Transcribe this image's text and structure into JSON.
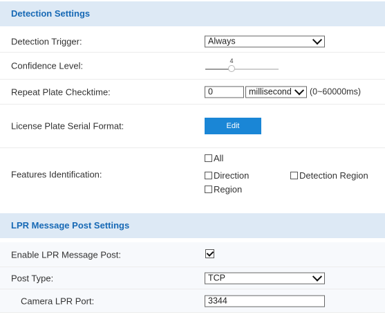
{
  "detection": {
    "header": "Detection Settings",
    "trigger": {
      "label": "Detection Trigger:",
      "value": "Always"
    },
    "confidence": {
      "label": "Confidence Level:",
      "value": "4",
      "level": 0.36
    },
    "repeat": {
      "label": "Repeat Plate Checktime:",
      "value": "0",
      "unit": "millisecond",
      "range": "(0~60000ms)"
    },
    "serial": {
      "label": "License Plate Serial Format:",
      "button": "Edit"
    },
    "features": {
      "label": "Features Identification:",
      "all": "All",
      "direction": "Direction",
      "detection_region": "Detection Region",
      "region": "Region"
    }
  },
  "lpr": {
    "header": "LPR Message Post Settings",
    "enable": {
      "label": "Enable LPR Message Post:",
      "checked": true
    },
    "post_type": {
      "label": "Post Type:",
      "value": "TCP"
    },
    "port": {
      "label": "Camera LPR Port:",
      "value": "3344"
    }
  },
  "colors": {
    "header_bg": "#dde9f5",
    "header_text": "#1769b5",
    "button": "#1a86d6"
  }
}
